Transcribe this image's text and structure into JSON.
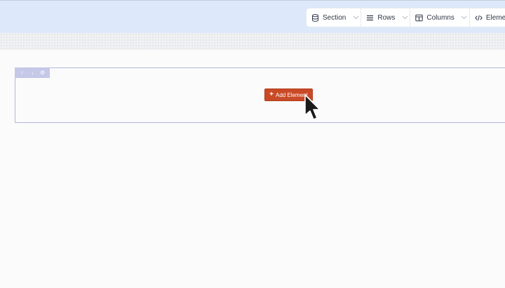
{
  "toolbar": {
    "items": [
      {
        "label": "Section",
        "icon": "database-icon"
      },
      {
        "label": "Rows",
        "icon": "bars-icon"
      },
      {
        "label": "Columns",
        "icon": "columns-layout-icon"
      },
      {
        "label": "Elements",
        "icon": "code-icon"
      }
    ]
  },
  "section": {
    "tools": [
      {
        "icon": "arrow-up-icon",
        "glyph": "↑"
      },
      {
        "icon": "arrow-down-icon",
        "glyph": "↓"
      },
      {
        "icon": "gear-icon",
        "glyph": "⚙"
      }
    ],
    "add_element_label": "Add Element"
  },
  "colors": {
    "topbar_bg": "#dde9fb",
    "accent": "#c94a26",
    "section_border": "#b3b6dc",
    "section_tools_bg": "#c5c8e6"
  }
}
